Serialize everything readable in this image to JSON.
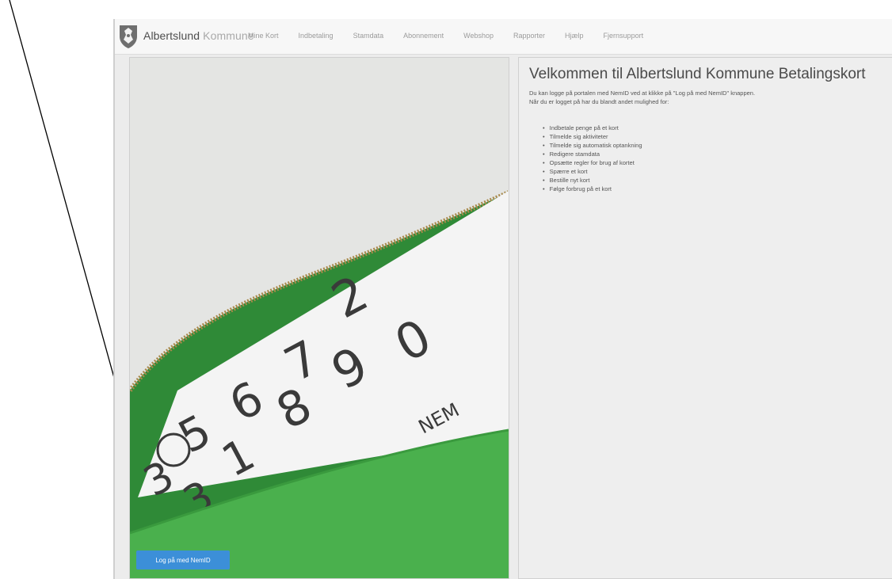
{
  "header": {
    "brand_primary": "Albertslund",
    "brand_secondary": "Kommune",
    "logo_icon": "albertslund-crest-icon"
  },
  "nav": {
    "items": [
      {
        "label": "Mine Kort"
      },
      {
        "label": "Indbetaling"
      },
      {
        "label": "Stamdata"
      },
      {
        "label": "Abonnement"
      },
      {
        "label": "Webshop"
      },
      {
        "label": "Rapporter"
      },
      {
        "label": "Hjælp"
      },
      {
        "label": "Fjernsupport"
      }
    ]
  },
  "hero": {
    "card_brand": "NEM"
  },
  "login": {
    "button_label": "Log på med NemID"
  },
  "welcome": {
    "title": "Velkommen til Albertslund Kommune Betalingskort",
    "intro_line1": "Du kan logge på portalen med NemID ved at klikke på \"Log på med NemID\" knappen.",
    "intro_line2": "Når du er logget på har du blandt andet mulighed for:",
    "features": [
      {
        "text": "Indbetale penge på et kort"
      },
      {
        "text": "Tilmelde sig aktiviteter"
      },
      {
        "text": "Tilmelde sig automatisk optankning"
      },
      {
        "text": "Redigere stamdata"
      },
      {
        "text": "Opsætte regler for brug af kortet"
      },
      {
        "text": "Spærre et kort"
      },
      {
        "text": "Bestille nyt kort"
      },
      {
        "text": "Følge forbrug på et kort"
      }
    ]
  },
  "colors": {
    "accent": "#3c8fd8",
    "wallet_green": "#3a9a3e",
    "panel_bg": "#eeeeee"
  }
}
